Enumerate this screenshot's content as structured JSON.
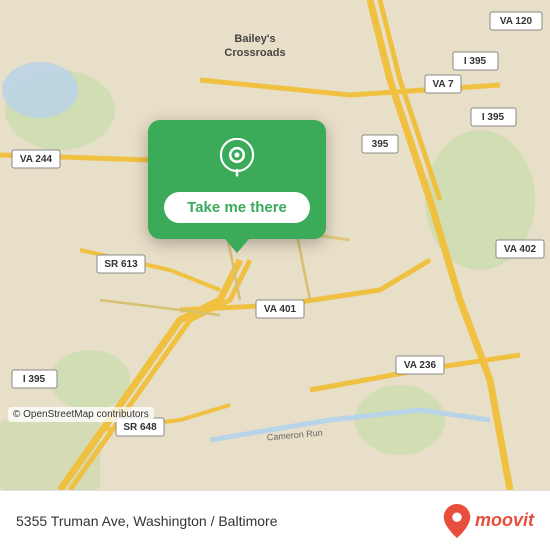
{
  "map": {
    "background_color": "#e8dfc8",
    "copyright": "© OpenStreetMap contributors"
  },
  "popup": {
    "button_label": "Take me there",
    "pin_color": "#ffffff"
  },
  "bottom_bar": {
    "address": "5355 Truman Ave, Washington / Baltimore",
    "moovit_label": "moovit"
  },
  "road_labels": [
    "VA 120",
    "VA 7",
    "I 395",
    "VA 402",
    "VA 244",
    "SR 613",
    "395",
    "VA 401",
    "VA 236",
    "I 395",
    "SR 648",
    "Cameron Run"
  ],
  "place_labels": [
    "Bailey's\nCrossroads"
  ]
}
